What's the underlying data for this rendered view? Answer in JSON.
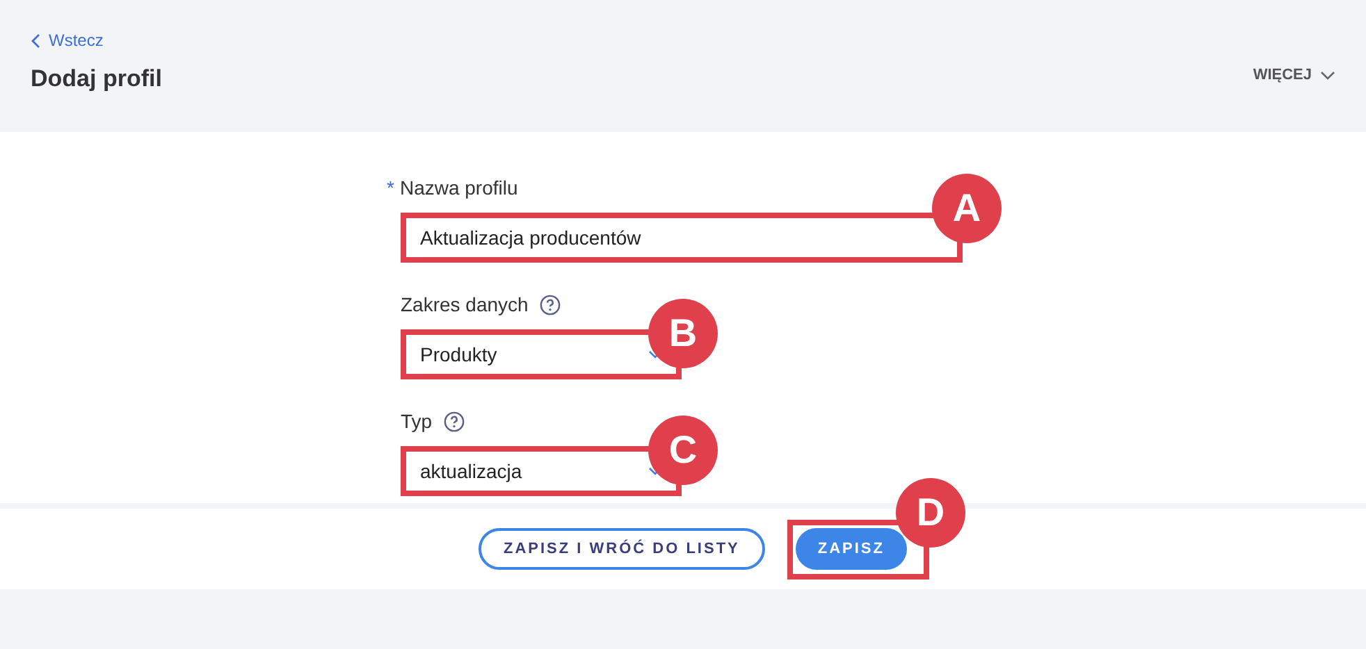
{
  "header": {
    "back": "Wstecz",
    "title": "Dodaj profil",
    "more": "WIĘCEJ"
  },
  "fields": [
    {
      "kind": "text",
      "label": "Nazwa profilu",
      "required_mark": "*",
      "help": false,
      "value": "Aktualizacja producentów",
      "annotation": "A"
    },
    {
      "kind": "select",
      "label": "Zakres danych",
      "help": true,
      "value": "Produkty",
      "annotation": "B"
    },
    {
      "kind": "select",
      "label": "Typ",
      "help": true,
      "value": "aktualizacja",
      "annotation": "C"
    }
  ],
  "buttons": [
    {
      "kind": "outline",
      "label": "ZAPISZ I WRÓĆ DO LISTY"
    },
    {
      "kind": "primary",
      "label": "ZAPISZ",
      "annotation": "D"
    }
  ]
}
